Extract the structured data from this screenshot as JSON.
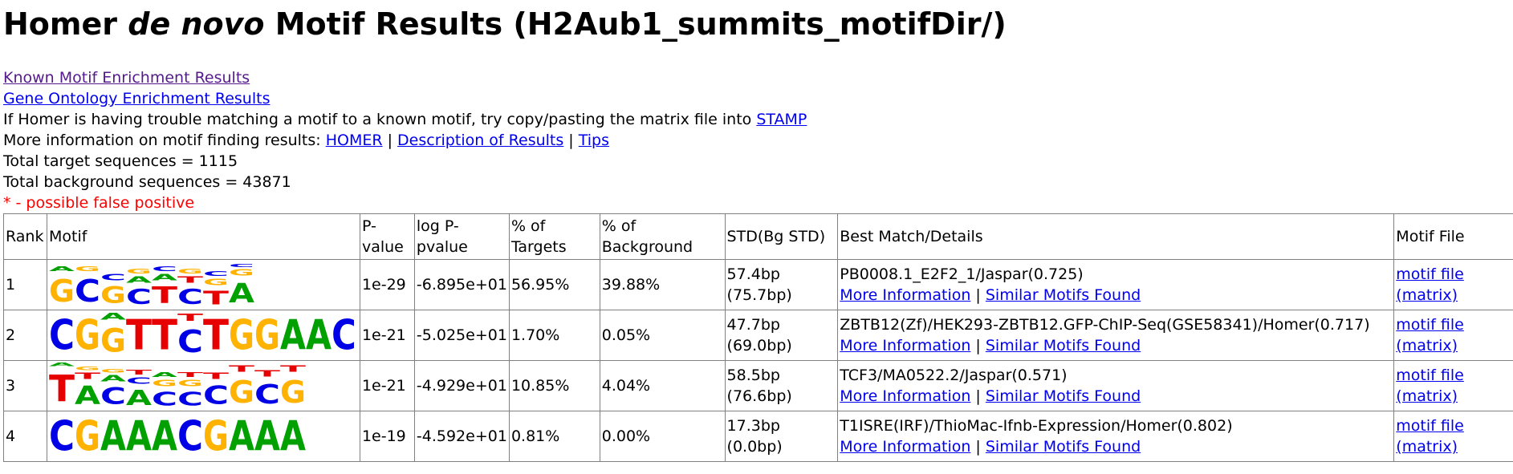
{
  "title": {
    "prefix": "Homer ",
    "italic": "de novo",
    "suffix": " Motif Results (H2Aub1_summits_motifDir/)"
  },
  "links": {
    "known": "Known Motif Enrichment Results",
    "go": "Gene Ontology Enrichment Results"
  },
  "stamp_line": {
    "text": "If Homer is having trouble matching a motif to a known motif, try copy/pasting the matrix file into ",
    "link": "STAMP"
  },
  "more_info_line": {
    "text": "More information on motif finding results: ",
    "homer": "HOMER",
    "sep1": " | ",
    "description": "Description of Results",
    "sep2": " | ",
    "tips": "Tips"
  },
  "total_target": "Total target sequences = 1115",
  "total_background": "Total background sequences = 43871",
  "false_positive_note": "* - possible false positive",
  "table": {
    "headers": {
      "rank": "Rank",
      "motif": "Motif",
      "pvalue_1": "P-",
      "pvalue_2": "value",
      "logp_1": "log P-",
      "logp_2": "pvalue",
      "targets_1": "% of",
      "targets_2": "Targets",
      "background_1": "% of",
      "background_2": "Background",
      "std": "STD(Bg STD)",
      "best_match": "Best Match/Details",
      "motif_file": "Motif File"
    },
    "rows": [
      {
        "rank": "1",
        "pvalue": "1e-29",
        "logp": "-6.895e+01",
        "targets": "56.95%",
        "background": "39.88%",
        "std": "57.4bp",
        "bg_std": "(75.7bp)",
        "best_match": "PB0008.1_E2F2_1/Jaspar(0.725)",
        "more_info": "More Information",
        "sep": " | ",
        "similar": "Similar Motifs Found",
        "file": "motif file",
        "matrix": "(matrix)"
      },
      {
        "rank": "2",
        "pvalue": "1e-21",
        "logp": "-5.025e+01",
        "targets": "1.70%",
        "background": "0.05%",
        "std": "47.7bp",
        "bg_std": "(69.0bp)",
        "best_match": "ZBTB12(Zf)/HEK293-ZBTB12.GFP-ChIP-Seq(GSE58341)/Homer(0.717)",
        "more_info": "More Information",
        "sep": " | ",
        "similar": "Similar Motifs Found",
        "file": "motif file",
        "matrix": "(matrix)"
      },
      {
        "rank": "3",
        "pvalue": "1e-21",
        "logp": "-4.929e+01",
        "targets": "10.85%",
        "background": "4.04%",
        "std": "58.5bp",
        "bg_std": "(76.6bp)",
        "best_match": "TCF3/MA0522.2/Jaspar(0.571)",
        "more_info": "More Information",
        "sep": " | ",
        "similar": "Similar Motifs Found",
        "file": "motif file",
        "matrix": "(matrix)"
      },
      {
        "rank": "4",
        "pvalue": "1e-19",
        "logp": "-4.592e+01",
        "targets": "0.81%",
        "background": "0.00%",
        "std": "17.3bp",
        "bg_std": "(0.0bp)",
        "best_match": "T1ISRE(IRF)/ThioMac-Ifnb-Expression/Homer(0.802)",
        "more_info": "More Information",
        "sep": " | ",
        "similar": "Similar Motifs Found",
        "file": "motif file",
        "matrix": "(matrix)"
      }
    ]
  },
  "logo_colors": {
    "A": "#00a000",
    "C": "#0000e6",
    "G": "#ffb300",
    "T": "#e60000"
  },
  "logos": [
    [
      [
        [
          "G",
          0.75
        ],
        [
          "A",
          0.15
        ]
      ],
      [
        [
          "C",
          0.75
        ],
        [
          "G",
          0.15
        ]
      ],
      [
        [
          "G",
          0.55
        ],
        [
          "C",
          0.2
        ]
      ],
      [
        [
          "C",
          0.5
        ],
        [
          "A",
          0.2
        ],
        [
          "G",
          0.15
        ]
      ],
      [
        [
          "T",
          0.55
        ],
        [
          "A",
          0.2
        ],
        [
          "C",
          0.15
        ]
      ],
      [
        [
          "C",
          0.5
        ],
        [
          "T",
          0.2
        ],
        [
          "G",
          0.15
        ]
      ],
      [
        [
          "T",
          0.45
        ],
        [
          "G",
          0.2
        ],
        [
          "C",
          0.15
        ]
      ],
      [
        [
          "A",
          0.65
        ],
        [
          "G",
          0.2
        ],
        [
          "C",
          0.1
        ]
      ]
    ],
    [
      [
        [
          "C",
          1.0
        ]
      ],
      [
        [
          "G",
          1.0
        ]
      ],
      [
        [
          "G",
          0.78
        ],
        [
          "A",
          0.22
        ]
      ],
      [
        [
          "T",
          1.0
        ]
      ],
      [
        [
          "T",
          1.0
        ]
      ],
      [
        [
          "C",
          0.75
        ],
        [
          "T",
          0.25
        ]
      ],
      [
        [
          "T",
          1.0
        ]
      ],
      [
        [
          "G",
          1.0
        ]
      ],
      [
        [
          "G",
          1.0
        ]
      ],
      [
        [
          "A",
          1.0
        ]
      ],
      [
        [
          "A",
          1.0
        ]
      ],
      [
        [
          "C",
          1.0
        ]
      ]
    ],
    [
      [
        [
          "T",
          0.88
        ],
        [
          "A",
          0.12
        ]
      ],
      [
        [
          "A",
          0.6
        ],
        [
          "T",
          0.2
        ],
        [
          "G",
          0.12
        ]
      ],
      [
        [
          "C",
          0.55
        ],
        [
          "A",
          0.2
        ],
        [
          "G",
          0.12
        ]
      ],
      [
        [
          "A",
          0.5
        ],
        [
          "C",
          0.2
        ],
        [
          "T",
          0.15
        ]
      ],
      [
        [
          "C",
          0.45
        ],
        [
          "G",
          0.2
        ],
        [
          "A",
          0.15
        ]
      ],
      [
        [
          "C",
          0.45
        ],
        [
          "G",
          0.2
        ],
        [
          "T",
          0.15
        ]
      ],
      [
        [
          "C",
          0.6
        ],
        [
          "T",
          0.2
        ]
      ],
      [
        [
          "G",
          0.75
        ],
        [
          "T",
          0.2
        ]
      ],
      [
        [
          "C",
          0.65
        ],
        [
          "T",
          0.2
        ]
      ],
      [
        [
          "G",
          0.75
        ],
        [
          "T",
          0.2
        ]
      ]
    ],
    [
      [
        [
          "C",
          1.0
        ]
      ],
      [
        [
          "G",
          1.0
        ]
      ],
      [
        [
          "A",
          1.0
        ]
      ],
      [
        [
          "A",
          1.0
        ]
      ],
      [
        [
          "A",
          1.0
        ]
      ],
      [
        [
          "C",
          1.0
        ]
      ],
      [
        [
          "G",
          1.0
        ]
      ],
      [
        [
          "A",
          1.0
        ]
      ],
      [
        [
          "A",
          1.0
        ]
      ],
      [
        [
          "A",
          1.0
        ]
      ]
    ]
  ]
}
